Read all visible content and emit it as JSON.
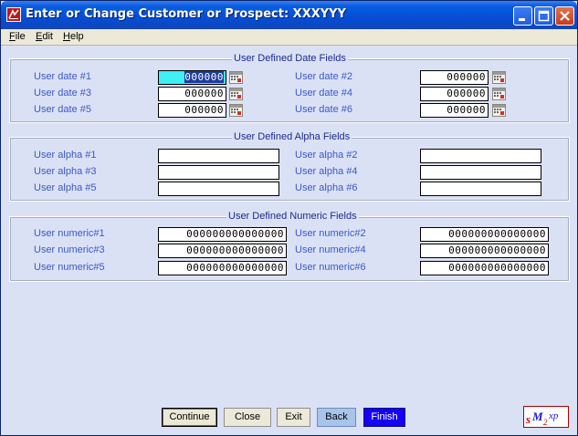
{
  "window": {
    "title": "Enter or Change Customer or Prospect: XXXYYY",
    "controls": [
      "minimize",
      "maximize",
      "close"
    ]
  },
  "menu": [
    {
      "label": "File",
      "mnemonic": "F",
      "rest": "ile"
    },
    {
      "label": "Edit",
      "mnemonic": "E",
      "rest": "dit"
    },
    {
      "label": "Help",
      "mnemonic": "H",
      "rest": "elp"
    }
  ],
  "date_group": {
    "title": "User Defined Date Fields",
    "fields": [
      {
        "label": "User date #1",
        "value": "000000",
        "focused": true
      },
      {
        "label": "User date #2",
        "value": "000000"
      },
      {
        "label": "User date #3",
        "value": "000000"
      },
      {
        "label": "User date #4",
        "value": "000000"
      },
      {
        "label": "User date #5",
        "value": "000000"
      },
      {
        "label": "User date #6",
        "value": "000000"
      }
    ]
  },
  "alpha_group": {
    "title": "User Defined Alpha Fields",
    "fields": [
      {
        "label": "User alpha #1",
        "value": ""
      },
      {
        "label": "User alpha #2",
        "value": ""
      },
      {
        "label": "User alpha #3",
        "value": ""
      },
      {
        "label": "User alpha #4",
        "value": ""
      },
      {
        "label": "User alpha #5",
        "value": ""
      },
      {
        "label": "User alpha #6",
        "value": ""
      }
    ]
  },
  "numeric_group": {
    "title": "User Defined Numeric Fields",
    "fields": [
      {
        "label": "User numeric#1",
        "value": "000000000000000"
      },
      {
        "label": "User numeric#2",
        "value": "000000000000000"
      },
      {
        "label": "User numeric#3",
        "value": "000000000000000"
      },
      {
        "label": "User numeric#4",
        "value": "000000000000000"
      },
      {
        "label": "User numeric#5",
        "value": "000000000000000"
      },
      {
        "label": "User numeric#6",
        "value": "000000000000000"
      }
    ]
  },
  "buttons": {
    "continue": "Continue",
    "close": "Close",
    "exit": "Exit",
    "back": "Back",
    "finish": "Finish"
  },
  "logo": {
    "text": "SM2XP",
    "icon": "sm2xp-logo"
  },
  "colors": {
    "title_bar": "#0550d8",
    "window_bg": "#dbe1f5",
    "label_text": "#3a58c8",
    "group_title": "#1a2b8e",
    "focused_field": "#3cf0f4",
    "selection": "#1e3d9e",
    "finish_button": "#1600f6",
    "back_button": "#a8c4ea"
  }
}
